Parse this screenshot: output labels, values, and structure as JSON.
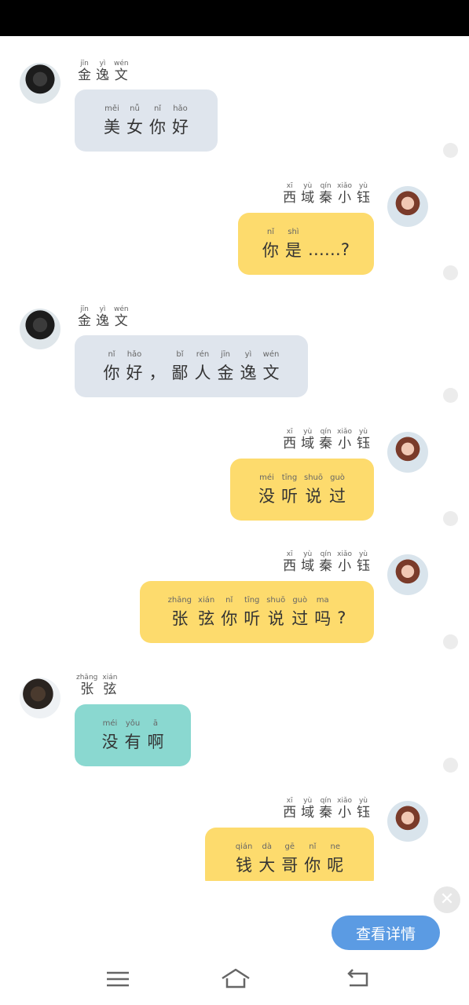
{
  "messages": [
    {
      "side": "left",
      "avatar": "jin",
      "sender": [
        {
          "py": "jīn",
          "ch": "金"
        },
        {
          "py": "yì",
          "ch": "逸"
        },
        {
          "py": "wén",
          "ch": "文"
        }
      ],
      "bubble": "gray",
      "text": [
        {
          "py": "měi",
          "ch": "美"
        },
        {
          "py": "nǚ",
          "ch": "女"
        },
        {
          "py": "nǐ",
          "ch": "你"
        },
        {
          "py": "hǎo",
          "ch": "好"
        }
      ]
    },
    {
      "side": "right",
      "avatar": "qin",
      "sender": [
        {
          "py": "xī",
          "ch": "西"
        },
        {
          "py": "yù",
          "ch": "域"
        },
        {
          "py": "qín",
          "ch": "秦"
        },
        {
          "py": "xiǎo",
          "ch": "小"
        },
        {
          "py": "yù",
          "ch": "钰"
        }
      ],
      "bubble": "yellow",
      "text": [
        {
          "py": "nǐ",
          "ch": "你"
        },
        {
          "py": "shì",
          "ch": "是"
        },
        {
          "py": "",
          "ch": "……?"
        }
      ]
    },
    {
      "side": "left",
      "avatar": "jin",
      "sender": [
        {
          "py": "jīn",
          "ch": "金"
        },
        {
          "py": "yì",
          "ch": "逸"
        },
        {
          "py": "wén",
          "ch": "文"
        }
      ],
      "bubble": "gray",
      "text": [
        {
          "py": "nǐ",
          "ch": "你"
        },
        {
          "py": "hǎo",
          "ch": "好"
        },
        {
          "py": "",
          "ch": "，"
        },
        {
          "py": "bǐ",
          "ch": "鄙"
        },
        {
          "py": "rén",
          "ch": "人"
        },
        {
          "py": "jīn",
          "ch": "金"
        },
        {
          "py": "yì",
          "ch": "逸"
        },
        {
          "py": "wén",
          "ch": "文"
        }
      ]
    },
    {
      "side": "right",
      "avatar": "qin",
      "sender": [
        {
          "py": "xī",
          "ch": "西"
        },
        {
          "py": "yù",
          "ch": "域"
        },
        {
          "py": "qín",
          "ch": "秦"
        },
        {
          "py": "xiǎo",
          "ch": "小"
        },
        {
          "py": "yù",
          "ch": "钰"
        }
      ],
      "bubble": "yellow",
      "text": [
        {
          "py": "méi",
          "ch": "没"
        },
        {
          "py": "tīng",
          "ch": "听"
        },
        {
          "py": "shuō",
          "ch": "说"
        },
        {
          "py": "guò",
          "ch": "过"
        }
      ]
    },
    {
      "side": "right",
      "avatar": "qin",
      "sender": [
        {
          "py": "xī",
          "ch": "西"
        },
        {
          "py": "yù",
          "ch": "域"
        },
        {
          "py": "qín",
          "ch": "秦"
        },
        {
          "py": "xiǎo",
          "ch": "小"
        },
        {
          "py": "yù",
          "ch": "钰"
        }
      ],
      "bubble": "yellow",
      "text": [
        {
          "py": "zhāng",
          "ch": "张"
        },
        {
          "py": "xián",
          "ch": "弦"
        },
        {
          "py": "nǐ",
          "ch": "你"
        },
        {
          "py": "tīng",
          "ch": "听"
        },
        {
          "py": "shuō",
          "ch": "说"
        },
        {
          "py": "guò",
          "ch": "过"
        },
        {
          "py": "ma",
          "ch": "吗"
        },
        {
          "py": "",
          "ch": "?"
        }
      ]
    },
    {
      "side": "left",
      "avatar": "zhang",
      "sender": [
        {
          "py": "zhāng",
          "ch": "张"
        },
        {
          "py": "xián",
          "ch": "弦"
        }
      ],
      "bubble": "teal",
      "text": [
        {
          "py": "méi",
          "ch": "没"
        },
        {
          "py": "yǒu",
          "ch": "有"
        },
        {
          "py": "ā",
          "ch": "啊"
        }
      ]
    },
    {
      "side": "right",
      "avatar": "qin",
      "sender": [
        {
          "py": "xī",
          "ch": "西"
        },
        {
          "py": "yù",
          "ch": "域"
        },
        {
          "py": "qín",
          "ch": "秦"
        },
        {
          "py": "xiǎo",
          "ch": "小"
        },
        {
          "py": "yù",
          "ch": "钰"
        }
      ],
      "bubble": "yellow",
      "text": [
        {
          "py": "qián",
          "ch": "钱"
        },
        {
          "py": "dà",
          "ch": "大"
        },
        {
          "py": "gē",
          "ch": "哥"
        },
        {
          "py": "nǐ",
          "ch": "你"
        },
        {
          "py": "ne",
          "ch": "呢"
        }
      ]
    }
  ],
  "detail_button": "查看详情",
  "close_label": "✕"
}
